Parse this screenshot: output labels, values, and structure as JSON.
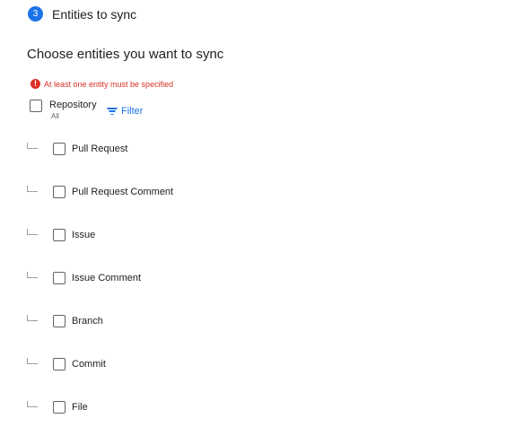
{
  "step": {
    "number": "3",
    "title": "Entities to sync"
  },
  "section": {
    "title": "Choose entities you want to sync"
  },
  "error": {
    "icon": "!",
    "message": "At least one entity must be specified"
  },
  "repository": {
    "label": "Repository",
    "sublabel": "All",
    "checked": false
  },
  "filter": {
    "label": "Filter",
    "icon": "filter-icon"
  },
  "entities": [
    {
      "label": "Pull Request",
      "checked": false
    },
    {
      "label": "Pull Request Comment",
      "checked": false
    },
    {
      "label": "Issue",
      "checked": false
    },
    {
      "label": "Issue Comment",
      "checked": false
    },
    {
      "label": "Branch",
      "checked": false
    },
    {
      "label": "Commit",
      "checked": false
    },
    {
      "label": "File",
      "checked": false
    }
  ],
  "colors": {
    "accent": "#1a73e8",
    "error": "#d93025",
    "text": "#202124",
    "muted": "#5f6368"
  }
}
